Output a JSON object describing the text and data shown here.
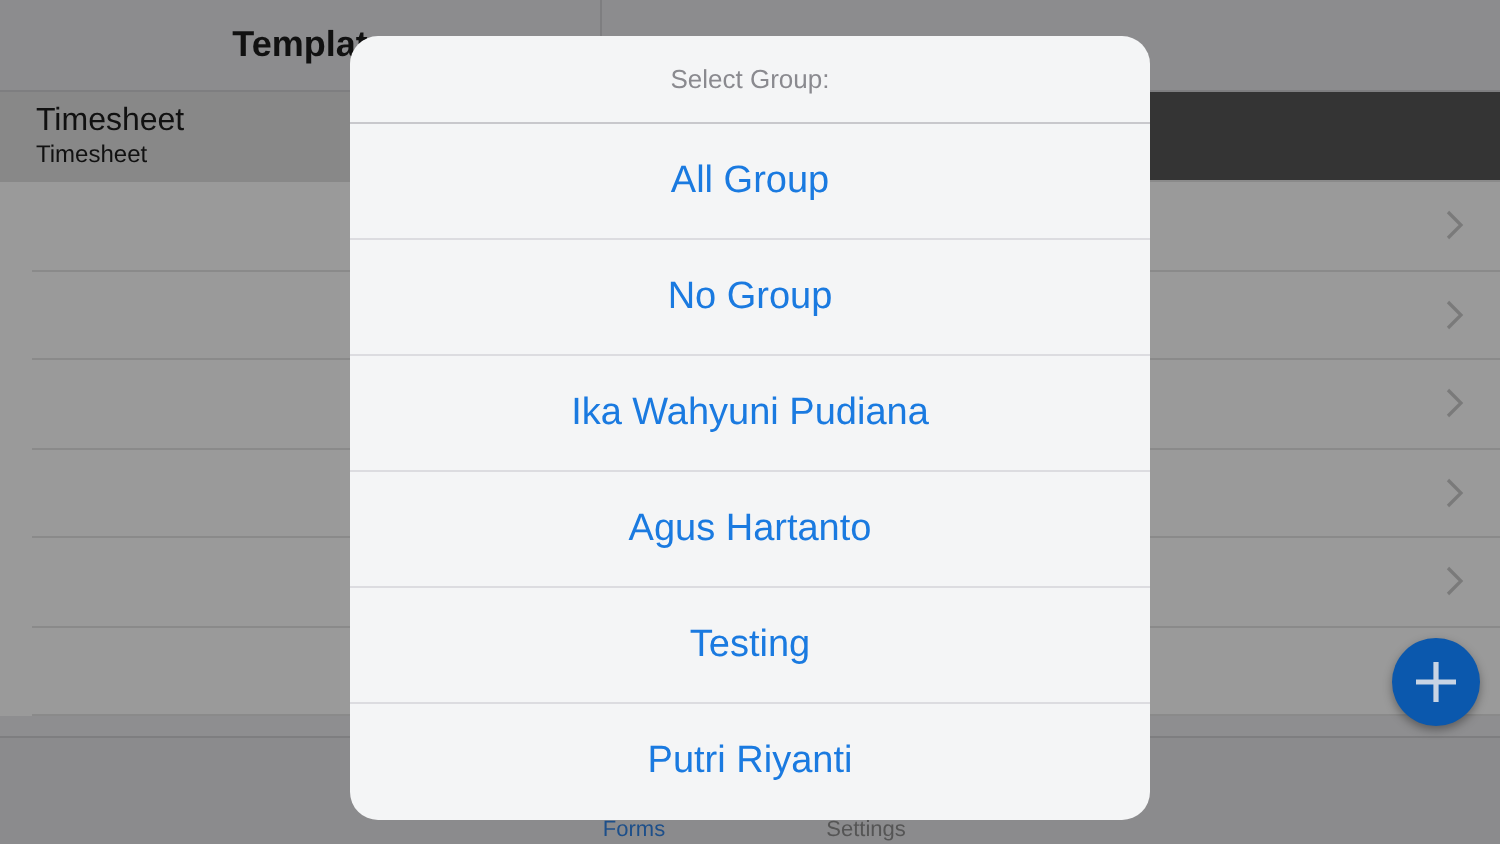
{
  "header": {
    "tabs": [
      {
        "label": "Templat",
        "selected": true
      }
    ]
  },
  "list": {
    "rows": [
      {
        "title": "Timesheet",
        "subtitle": "Timesheet",
        "selected": true
      },
      {
        "selected": false
      },
      {
        "selected": false
      },
      {
        "selected": false
      },
      {
        "selected": false
      },
      {
        "selected": false
      },
      {
        "selected": false
      }
    ]
  },
  "tab_bar": {
    "items": [
      {
        "label": "Forms",
        "selected": true
      },
      {
        "label": "Settings",
        "selected": false
      }
    ]
  },
  "dialog": {
    "title": "Select Group:",
    "options": [
      "All Group",
      "No Group",
      "Ika Wahyuni Pudiana",
      "Agus Hartanto",
      "Testing",
      "Putri Riyanti"
    ]
  }
}
